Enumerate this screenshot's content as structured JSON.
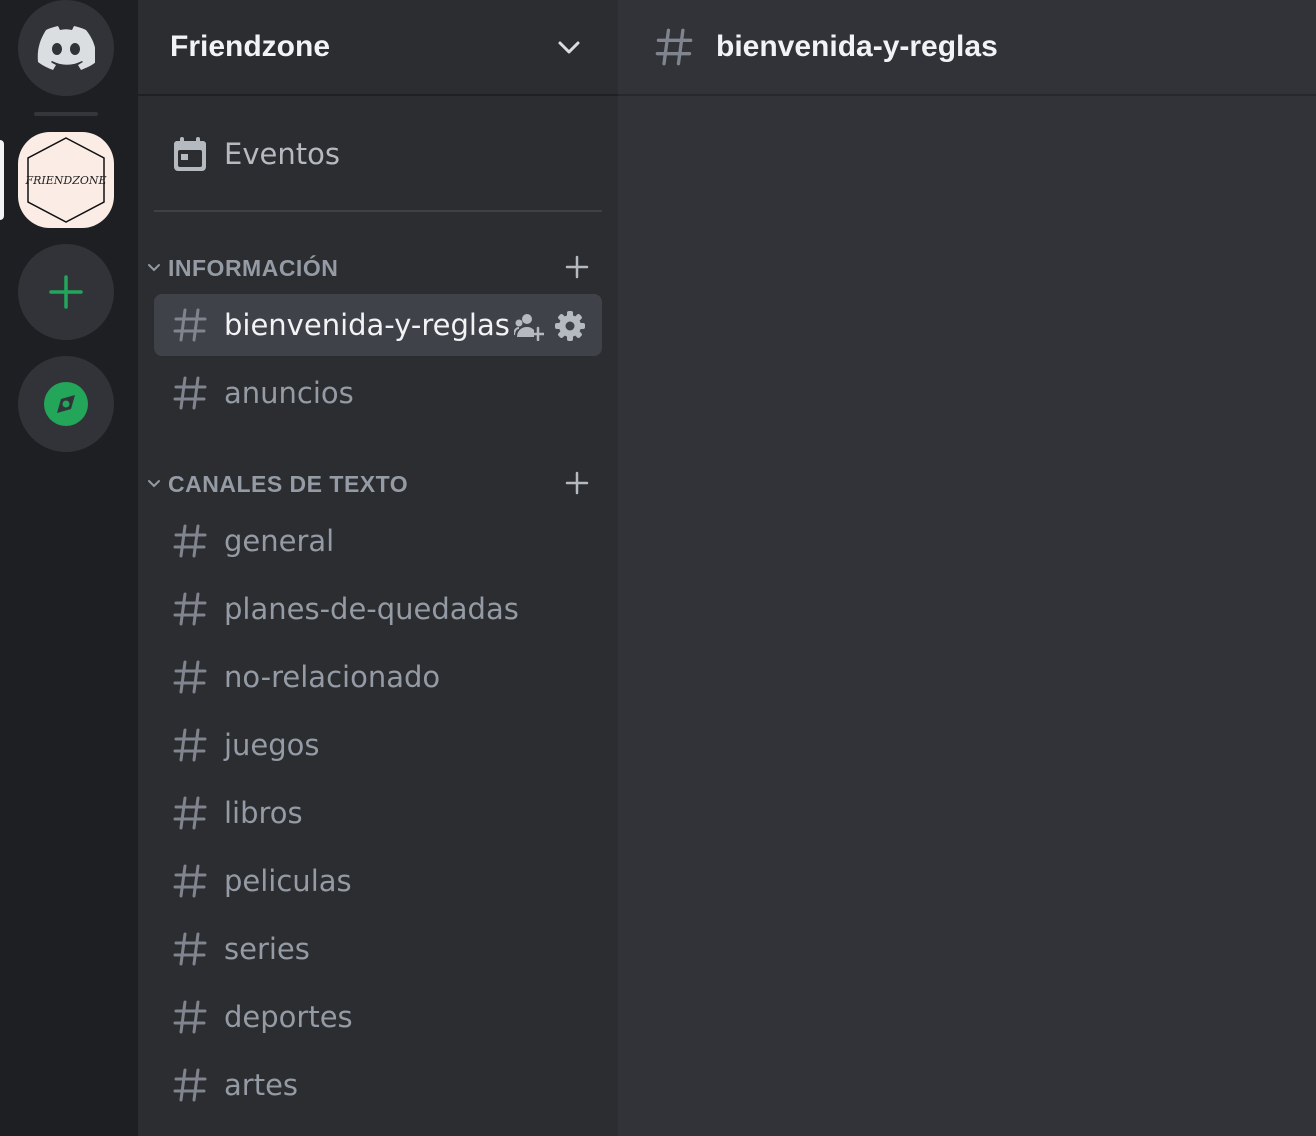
{
  "server_rail": {
    "home_icon": "discord-logo-icon",
    "server_logo_text": "FRIENDZONE",
    "add_icon": "plus-icon",
    "explore_icon": "compass-icon",
    "colors": {
      "accent_green": "#23a55a"
    }
  },
  "sidebar": {
    "server_name": "Friendzone",
    "events_label": "Eventos",
    "categories": [
      {
        "label": "INFORMACIÓN",
        "channels": [
          {
            "name": "bienvenida-y-reglas",
            "active": true
          },
          {
            "name": "anuncios",
            "active": false
          }
        ]
      },
      {
        "label": "CANALES DE TEXTO",
        "channels": [
          {
            "name": "general"
          },
          {
            "name": "planes-de-quedadas"
          },
          {
            "name": "no-relacionado"
          },
          {
            "name": "juegos"
          },
          {
            "name": "libros"
          },
          {
            "name": "peliculas"
          },
          {
            "name": "series"
          },
          {
            "name": "deportes"
          },
          {
            "name": "artes"
          }
        ]
      }
    ]
  },
  "main": {
    "channel_title": "bienvenida-y-reglas"
  }
}
